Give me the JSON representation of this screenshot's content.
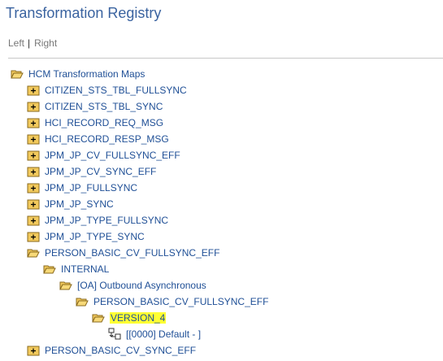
{
  "page": {
    "title": "Transformation Registry"
  },
  "nav": {
    "left": "Left",
    "right": "Right"
  },
  "tree": {
    "root": "HCM Transformation Maps",
    "items": [
      "CITIZEN_STS_TBL_FULLSYNC",
      "CITIZEN_STS_TBL_SYNC",
      "HCI_RECORD_REQ_MSG",
      "HCI_RECORD_RESP_MSG",
      "JPM_JP_CV_FULLSYNC_EFF",
      "JPM_JP_CV_SYNC_EFF",
      "JPM_JP_FULLSYNC",
      "JPM_JP_SYNC",
      "JPM_JP_TYPE_FULLSYNC",
      "JPM_JP_TYPE_SYNC",
      "PERSON_BASIC_CV_FULLSYNC_EFF"
    ],
    "internal": "INTERNAL",
    "outbound": "[OA] Outbound Asynchronous",
    "person_map": "PERSON_BASIC_CV_FULLSYNC_EFF",
    "version": "VERSION_4",
    "default_entry": "[[0000] Default - ]",
    "last_item": "PERSON_BASIC_CV_SYNC_EFF"
  },
  "colors": {
    "title": "#3a63a0",
    "link": "#1f4f96",
    "folder": "#f2c95c",
    "folder_edge": "#8a6a1e",
    "highlight": "#ffff33"
  },
  "icons": {
    "open_folder": "folder-open-icon",
    "closed_folder_plus": "folder-plus-icon",
    "map_entry": "map-entry-icon"
  }
}
